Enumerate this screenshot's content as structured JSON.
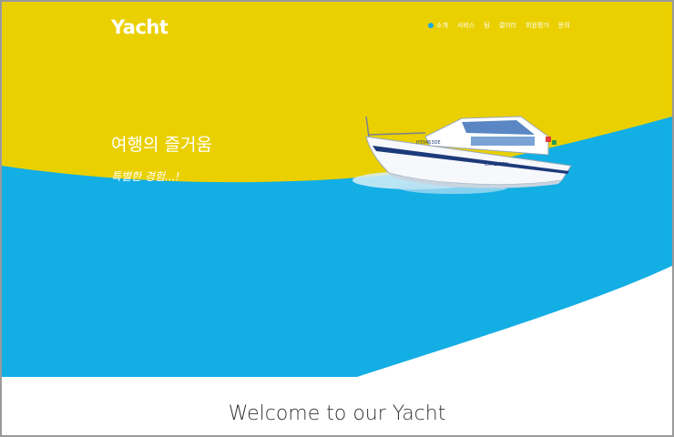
{
  "brand": {
    "logo_text": "Yacht"
  },
  "nav": {
    "items": [
      {
        "label": "소개",
        "active": true
      },
      {
        "label": "서비스"
      },
      {
        "label": "팀"
      },
      {
        "label": "갤러리"
      },
      {
        "label": "회원평가"
      },
      {
        "label": "문의"
      }
    ]
  },
  "hero": {
    "title": "여행의 즐거움",
    "subtitle": "특별한 경험...!",
    "boat_label": "EXPLORER",
    "boat_reg": "HT0453DE"
  },
  "welcome": {
    "heading": "Welcome to our Yacht"
  },
  "colors": {
    "yellow": "#ead000",
    "blue": "#13aee4",
    "white": "#ffffff",
    "active_dot": "#1aa9e0"
  }
}
